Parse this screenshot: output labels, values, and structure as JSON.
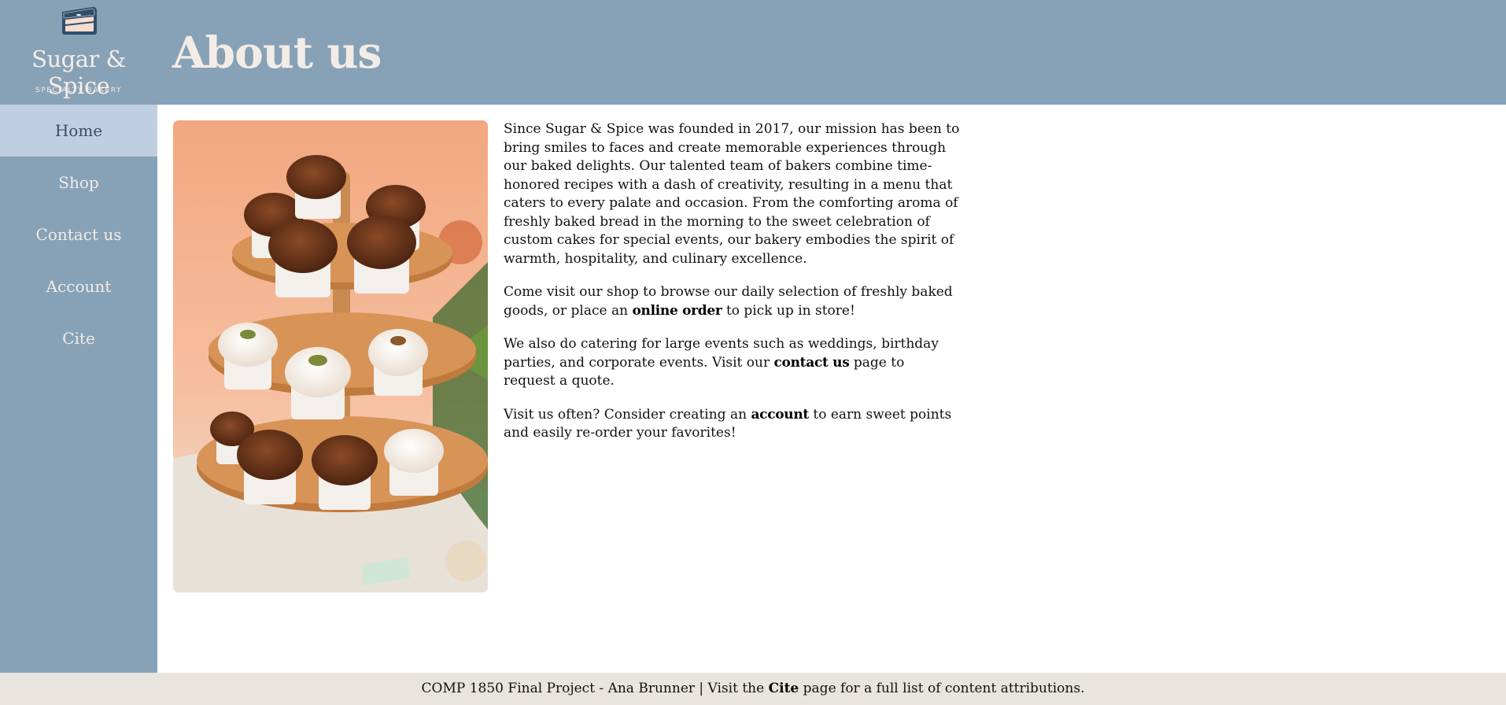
{
  "brand": {
    "name": "Sugar & Spice",
    "tagline": "SPECIALTY BAKERY",
    "logo_icon": "cake-slice-icon"
  },
  "page": {
    "title": "About us"
  },
  "nav": {
    "items": [
      {
        "label": "Home",
        "active": true
      },
      {
        "label": "Shop"
      },
      {
        "label": "Contact us"
      },
      {
        "label": "Account"
      },
      {
        "label": "Cite"
      }
    ]
  },
  "content": {
    "paragraph_1": "Since Sugar & Spice was founded in 2017, our mission has been to bring smiles to faces and create memorable experiences through our baked delights. Our talented team of bakers combine time-honored recipes with a dash of creativity, resulting in a menu that caters to every palate and occasion. From the comforting aroma of freshly baked bread in the morning to the sweet celebration of custom cakes for special events, our bakery embodies the spirit of warmth, hospitality, and culinary excellence.",
    "paragraph_2": {
      "before": "Come visit our shop to browse our daily selection of freshly baked goods, or place an ",
      "link": "online order",
      "after": " to pick up in store!"
    },
    "paragraph_3": {
      "before": "We also do catering for large events such as weddings, birthday parties, and corporate events. Visit our ",
      "link": "contact us",
      "after": " page to request a quote."
    },
    "paragraph_4": {
      "before": "Visit us often? Consider creating an ",
      "link": "account",
      "after": " to earn sweet points and easily re-order your favorites!"
    }
  },
  "footer": {
    "before": "COMP 1850 Final Project - Ana Brunner | Visit the ",
    "link": "Cite",
    "after": " page for a full list of content attributions."
  },
  "colors": {
    "header_bg": "#87a2b7",
    "nav_active_bg": "#bfcfe1",
    "footer_bg": "#e8e5df",
    "title_text": "#f3ece6"
  }
}
